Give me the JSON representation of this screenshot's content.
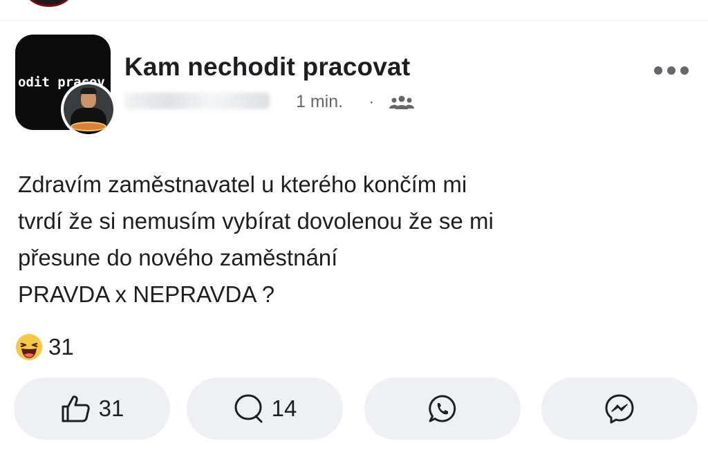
{
  "group": {
    "name": "Kam nechodit pracovat",
    "avatar_text": "odit pracov"
  },
  "post": {
    "time": "1 min.",
    "separator": "·",
    "audience_icon": "group-audience-icon",
    "more_icon": "more-options-icon",
    "text_lines": [
      "Zdravím zaměstnavatel u kterého končím mi",
      "tvrdí že si nemusím vybírat dovolenou že se mi",
      "přesune do nového zaměstnání",
      "PRAVDA x NEPRAVDA ?"
    ]
  },
  "reactions": {
    "icon": "haha-emoji-icon",
    "count": "31"
  },
  "actions": {
    "like": {
      "icon": "thumbs-up-icon",
      "count": "31"
    },
    "comment": {
      "icon": "comment-bubble-icon",
      "count": "14"
    },
    "whatsapp": {
      "icon": "whatsapp-icon"
    },
    "messenger": {
      "icon": "messenger-icon"
    }
  },
  "colors": {
    "text": "#1c1e21",
    "muted": "#65676b",
    "button_bg": "#eef0f3",
    "haha_yellow": "#f7c74a"
  }
}
